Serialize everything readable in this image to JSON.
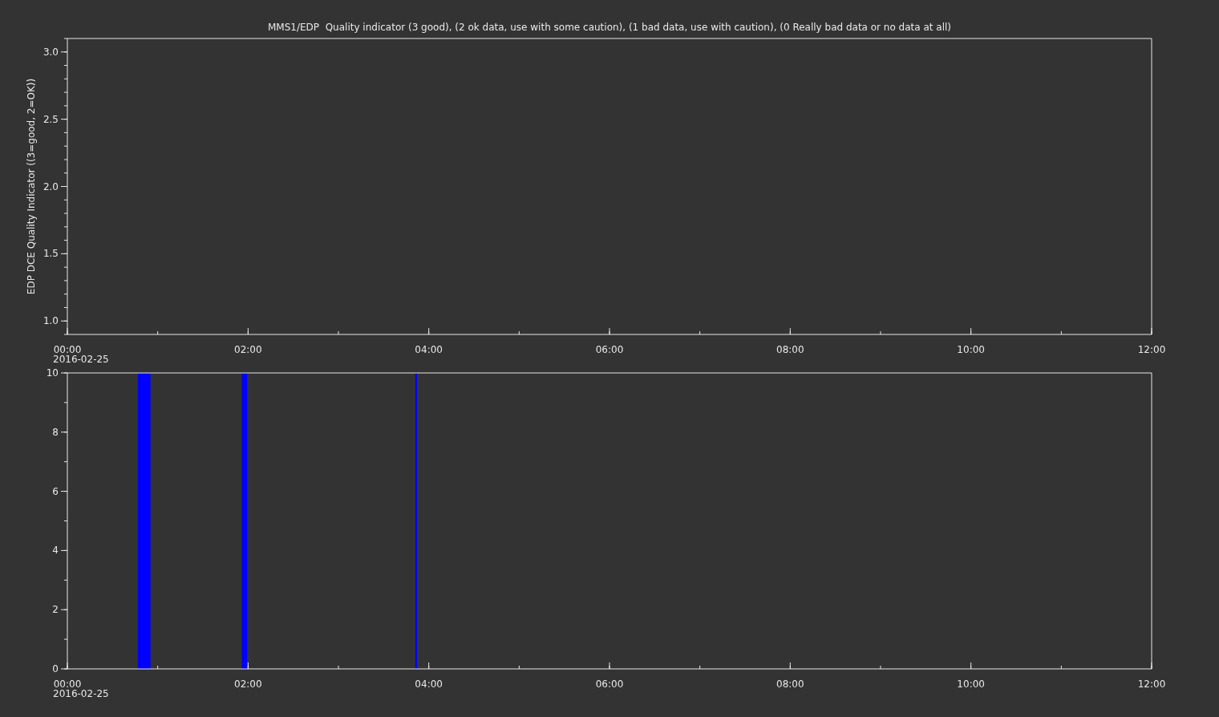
{
  "charts": [
    {
      "chart_data": {
        "type": "line",
        "title": "MMS1/EDP  Quality indicator (3 good), (2 ok data, use with some caution), (1 bad data, use with caution), (0 Really bad data or no data at all)",
        "ylabel": "EDP DCE Quality Indicator ((3=good, 2=OK))",
        "xlim": [
          0,
          12
        ],
        "ylim": [
          0.9,
          3.1
        ],
        "xticks": [
          {
            "value": 0,
            "label": "00:00"
          },
          {
            "value": 2,
            "label": "02:00"
          },
          {
            "value": 4,
            "label": "04:00"
          },
          {
            "value": 6,
            "label": "06:00"
          },
          {
            "value": 8,
            "label": "08:00"
          },
          {
            "value": 10,
            "label": "10:00"
          },
          {
            "value": 12,
            "label": "12:00"
          }
        ],
        "yticks": [
          {
            "value": 1,
            "label": "1.0"
          },
          {
            "value": 1.5,
            "label": "1.5"
          },
          {
            "value": 2,
            "label": "2.0"
          },
          {
            "value": 2.5,
            "label": "2.5"
          },
          {
            "value": 3,
            "label": "3.0"
          }
        ]
      },
      "date_label": "2016-02-25"
    },
    {
      "chart_data": {
        "type": "area",
        "xlim": [
          0,
          12
        ],
        "ylim": [
          0,
          10
        ],
        "xticks": [
          {
            "value": 0,
            "label": "00:00"
          },
          {
            "value": 2,
            "label": "02:00"
          },
          {
            "value": 4,
            "label": "04:00"
          },
          {
            "value": 6,
            "label": "06:00"
          },
          {
            "value": 8,
            "label": "08:00"
          },
          {
            "value": 10,
            "label": "10:00"
          },
          {
            "value": 12,
            "label": "12:00"
          }
        ],
        "yticks": [
          {
            "value": 0,
            "label": "0"
          },
          {
            "value": 2,
            "label": "2"
          },
          {
            "value": 4,
            "label": "4"
          },
          {
            "value": 6,
            "label": "6"
          },
          {
            "value": 8,
            "label": "8"
          },
          {
            "value": 10,
            "label": "10"
          }
        ],
        "x": [
          0.78,
          0.78,
          0.92,
          0.92,
          1.93,
          1.93,
          1.99,
          1.99,
          3.85,
          3.85,
          3.87,
          3.87
        ],
        "series": [
          {
            "color": "#0000ff",
            "values": [
              0,
              10,
              10,
              0,
              0,
              10,
              10,
              0,
              0,
              10,
              10,
              0
            ]
          }
        ]
      },
      "date_label": "2016-02-25"
    }
  ]
}
